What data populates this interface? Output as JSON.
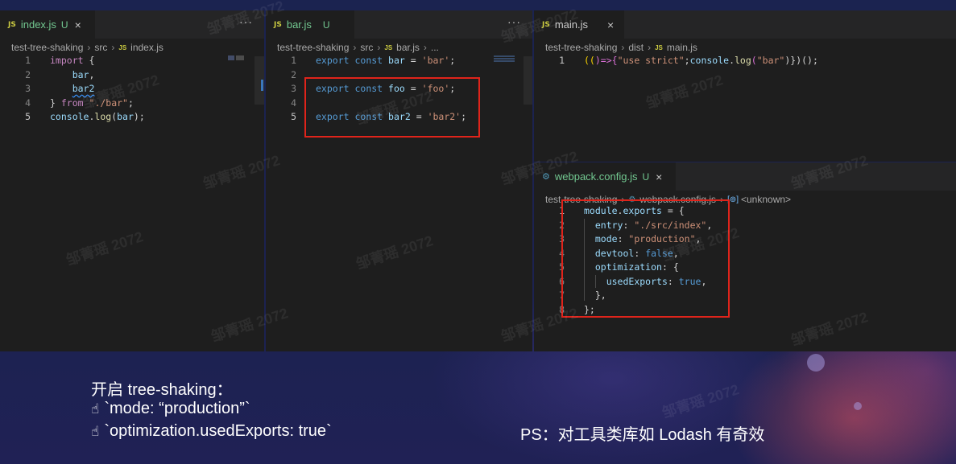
{
  "colors": {
    "red_box": "#e0241b",
    "editor_bg": "#1e1e1e",
    "slide_bg": "#1a2147"
  },
  "icons": {
    "js": "JS",
    "gear": "⚙",
    "close": "×",
    "more": "···",
    "hand": "☝",
    "bracket": "[⊚]"
  },
  "pane1": {
    "tab": {
      "name": "index.js",
      "badge": "U"
    },
    "crumbs": {
      "folder": "test-tree-shaking",
      "sub": "src",
      "file": "index.js"
    },
    "lines": [
      {
        "n": "1",
        "import": "import",
        "brace": "{"
      },
      {
        "n": "2",
        "item": "bar",
        "comma": ","
      },
      {
        "n": "3",
        "item": "bar2"
      },
      {
        "n": "4",
        "brace": "}",
        "from": "from",
        "path": "\"./bar\"",
        "semi": ";"
      },
      {
        "n": "5",
        "obj": "console",
        "dot": ".",
        "fn": "log",
        "open": "(",
        "arg": "bar",
        "close": ");"
      }
    ]
  },
  "pane2": {
    "tab": {
      "name": "bar.js",
      "badge": "U"
    },
    "crumbs": {
      "folder": "test-tree-shaking",
      "sub": "src",
      "file": "bar.js",
      "tail": "..."
    },
    "export": "export",
    "const": "const",
    "eq": "=",
    "semi": ";",
    "lines": [
      {
        "n": "1",
        "name": "bar",
        "value": "'bar'"
      },
      {
        "n": "2"
      },
      {
        "n": "3",
        "name": "foo",
        "value": "'foo'"
      },
      {
        "n": "4"
      },
      {
        "n": "5",
        "name": "bar2",
        "value": "'bar2'"
      }
    ]
  },
  "pane3": {
    "tab": {
      "name": "main.js"
    },
    "crumbs": {
      "folder": "test-tree-shaking",
      "sub": "dist",
      "file": "main.js"
    },
    "line": {
      "n": "1",
      "a": "((",
      "b": ")=>{",
      "str1": "\"use strict\"",
      "semi": ";",
      "obj": "console",
      "dot": ".",
      "fn": "log",
      "paren": "(",
      "str2": "\"bar\"",
      "end": ")})();"
    }
  },
  "pane4": {
    "tab": {
      "name": "webpack.config.js",
      "badge": "U"
    },
    "crumbs": {
      "folder": "test-tree-shaking",
      "file": "webpack.config.js",
      "symbol": "<unknown>"
    },
    "lines": [
      {
        "n": "1",
        "obj": "module",
        "dot": ".",
        "prop": "exports",
        "rest": " = {"
      },
      {
        "n": "2",
        "key": "entry",
        "colon": ": ",
        "val": "\"./src/index\"",
        "end": ","
      },
      {
        "n": "3",
        "key": "mode",
        "colon": ": ",
        "val": "\"production\"",
        "end": ","
      },
      {
        "n": "4",
        "key": "devtool",
        "colon": ": ",
        "bool": "false",
        "end": ","
      },
      {
        "n": "5",
        "key": "optimization",
        "colon": ": ",
        "end": "{"
      },
      {
        "n": "6",
        "key": "usedExports",
        "colon": ": ",
        "bool": "true",
        "end": ","
      },
      {
        "n": "7",
        "end": "},"
      },
      {
        "n": "8",
        "end": "};"
      }
    ]
  },
  "caption": {
    "title": "开启 tree-shaking：",
    "item1": "`mode: “production”`",
    "item2": "`optimization.usedExports: true`",
    "ps": "PS：对工具类库如 Lodash 有奇效"
  },
  "watermark": "邹菁瑶 2072"
}
